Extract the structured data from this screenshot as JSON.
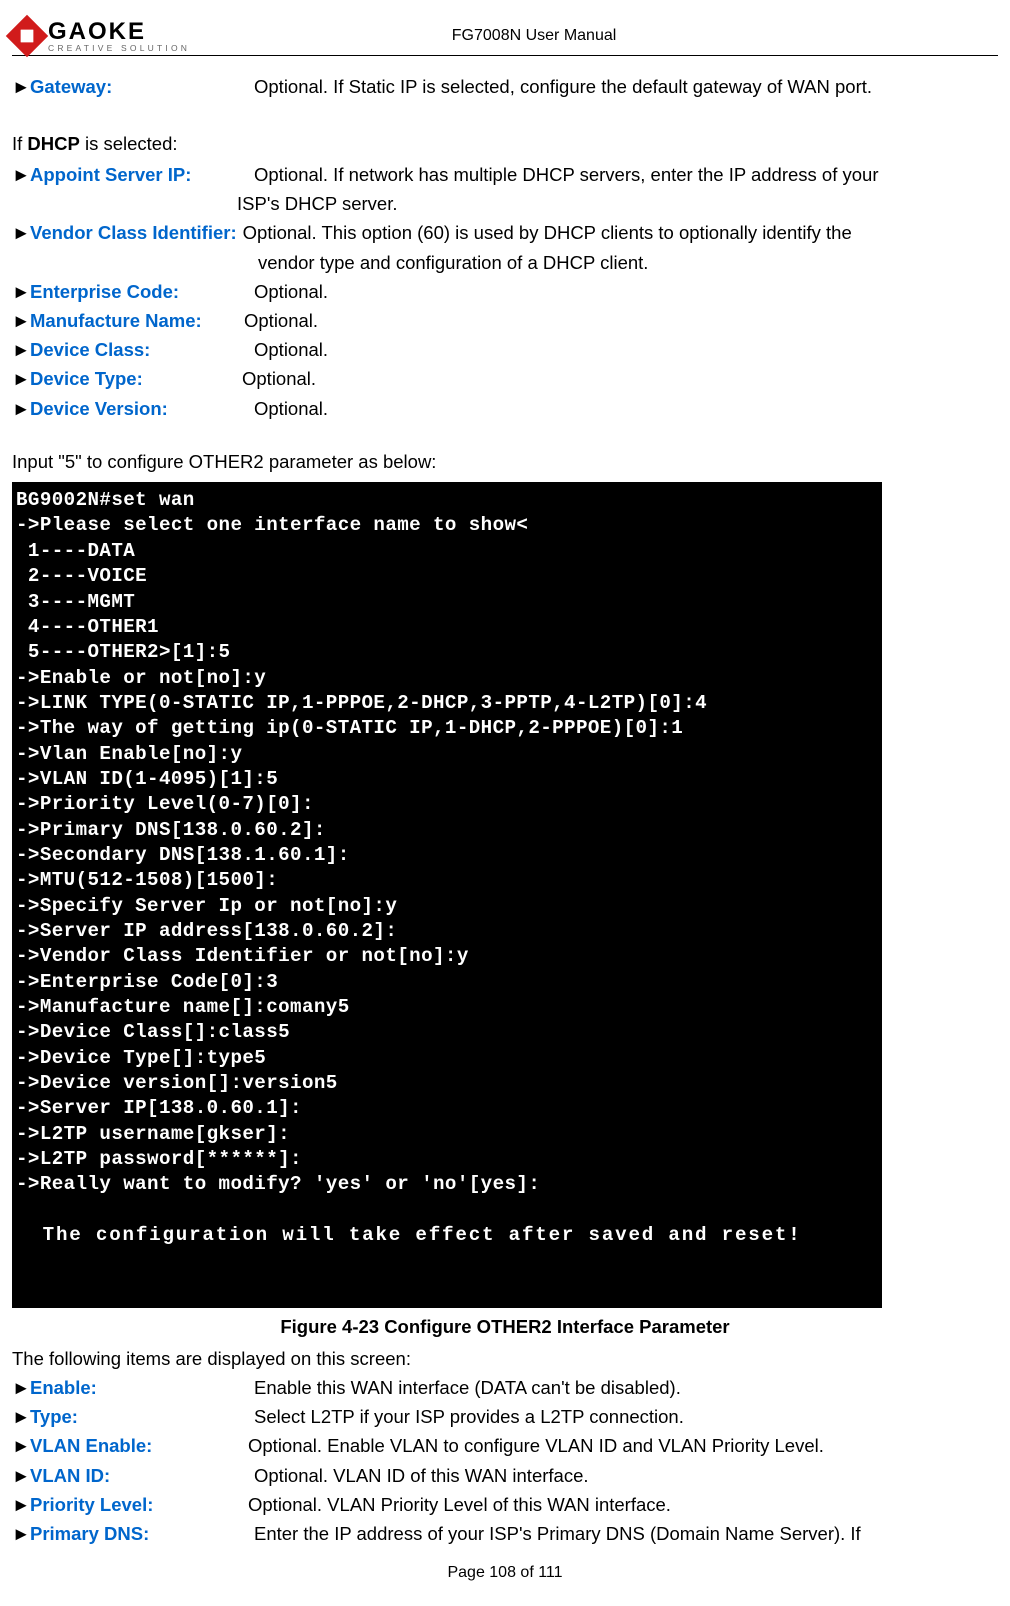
{
  "header": {
    "brand": "GAOKE",
    "tagline": "CREATIVE SOLUTION",
    "doc_title": "FG7008N User Manual"
  },
  "top_params": {
    "gateway": {
      "arrow": "►",
      "label": "Gateway:",
      "desc": "Optional. If Static IP is selected, configure the default gateway of WAN port."
    }
  },
  "dhcp_intro_pre": "If ",
  "dhcp_intro_bold": "DHCP",
  "dhcp_intro_post": " is selected:",
  "dhcp_params": {
    "appoint": {
      "arrow": "►",
      "label": "Appoint Server IP:",
      "desc1": "Optional. If network has multiple DHCP servers, enter the IP address of your",
      "desc2": "ISP's DHCP server."
    },
    "vendor": {
      "arrow": "►",
      "label": "Vendor Class Identifier:",
      "desc1": "Optional. This option (60) is used by DHCP clients to optionally identify the",
      "desc2": "vendor type and configuration of a DHCP client."
    },
    "enterprise": {
      "arrow": "►",
      "label": "Enterprise Code:",
      "desc": "Optional."
    },
    "manufacture": {
      "arrow": "►",
      "label": "Manufacture Name:",
      "desc": "Optional."
    },
    "devclass": {
      "arrow": "►",
      "label": "Device Class:",
      "desc": "Optional."
    },
    "devtype": {
      "arrow": "►",
      "label": "Device Type:",
      "desc": "Optional."
    },
    "devversion": {
      "arrow": "►",
      "label": "Device Version:",
      "desc": "Optional."
    }
  },
  "input5_text": "Input \"5\" to configure OTHER2 parameter as below:",
  "terminal": {
    "lines": [
      "BG9002N#set wan",
      "->Please select one interface name to show<",
      " 1----DATA",
      " 2----VOICE",
      " 3----MGMT",
      " 4----OTHER1",
      " 5----OTHER2>[1]:5",
      "->Enable or not[no]:y",
      "->LINK TYPE(0-STATIC IP,1-PPPOE,2-DHCP,3-PPTP,4-L2TP)[0]:4",
      "->The way of getting ip(0-STATIC IP,1-DHCP,2-PPPOE)[0]:1",
      "->Vlan Enable[no]:y",
      "->VLAN ID(1-4095)[1]:5",
      "->Priority Level(0-7)[0]:",
      "->Primary DNS[138.0.60.2]:",
      "->Secondary DNS[138.1.60.1]:",
      "->MTU(512-1508)[1500]:",
      "->Specify Server Ip or not[no]:y",
      "->Server IP address[138.0.60.2]:",
      "->Vendor Class Identifier or not[no]:y",
      "->Enterprise Code[0]:3",
      "->Manufacture name[]:comany5",
      "->Device Class[]:class5",
      "->Device Type[]:type5",
      "->Device version[]:version5",
      "->Server IP[138.0.60.1]:",
      "->L2TP username[gkser]:",
      "->L2TP password[******]:",
      "->Really want to modify? 'yes' or 'no'[yes]:"
    ],
    "msg": "  The configuration will take effect after saved and reset!"
  },
  "figure_caption": "Figure 4-23   Configure OTHER2 Interface Parameter",
  "post_fig_text": "The following items are displayed on this screen:",
  "bottom_params": {
    "enable": {
      "arrow": "►",
      "label": "Enable:",
      "desc": "Enable this WAN interface (DATA can't be disabled)."
    },
    "type": {
      "arrow": "►",
      "label": "Type:",
      "desc": "Select L2TP if your ISP provides a L2TP connection."
    },
    "vlan_enable": {
      "arrow": "►",
      "label": "VLAN Enable:",
      "desc": "Optional. Enable VLAN to configure VLAN ID and VLAN Priority Level."
    },
    "vlan_id": {
      "arrow": "►",
      "label": "VLAN ID:",
      "desc": "Optional. VLAN ID of this WAN interface."
    },
    "priority": {
      "arrow": "►",
      "label": "Priority Level:",
      "desc": "Optional. VLAN Priority Level of this WAN interface."
    },
    "primary_dns": {
      "arrow": "►",
      "label": "Primary DNS:",
      "desc": "Enter the IP address of your ISP's Primary DNS (Domain Name Server). If"
    }
  },
  "footer": "Page 108 of 111"
}
